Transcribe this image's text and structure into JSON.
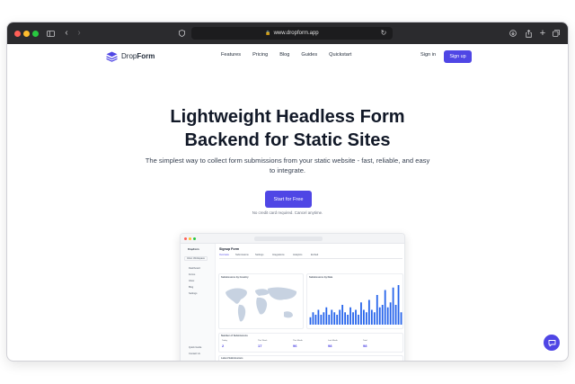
{
  "browser": {
    "url": "www.dropform.app",
    "colors": {
      "close": "#ff5f57",
      "minimize": "#febc2e",
      "maximize": "#28c840"
    }
  },
  "nav": {
    "brand_prefix": "Drop",
    "brand_suffix": "Form",
    "links": [
      "Features",
      "Pricing",
      "Blog",
      "Guides",
      "Quickstart"
    ],
    "sign_in": "Sign in",
    "sign_up": "Sign up"
  },
  "hero": {
    "title_line1": "Lightweight Headless Form",
    "title_line2": "Backend for Static Sites",
    "subtitle": "The simplest way to collect form submissions from your static website - fast, reliable, and easy to integrate.",
    "cta": "Start for Free",
    "cta_note": "No credit card required. Cancel anytime."
  },
  "preview": {
    "brand": "DropForm",
    "workspace": "Inbox Workspace",
    "side_items": [
      "Dashboard",
      "Forms",
      "Inbox",
      "Blog",
      "Settings"
    ],
    "side_bottom": [
      "Quick Guide",
      "Contact Us"
    ],
    "form_title": "Signup Form",
    "tabs": [
      "Overview",
      "Submissions",
      "Settings",
      "Integrations",
      "Analytics",
      "Embed"
    ],
    "submissions_by_country": "Submissions by Country",
    "submissions_by_date": "Submissions by Date",
    "number_of_submissions": "Number of Submissions",
    "latest_submissions": "Latest Submissions",
    "stats": [
      {
        "label": "Today",
        "value": "2"
      },
      {
        "label": "This Week",
        "value": "17"
      },
      {
        "label": "This Month",
        "value": "96"
      },
      {
        "label": "Last Month",
        "value": "98"
      },
      {
        "label": "Total",
        "value": "98"
      }
    ],
    "bar_values": [
      3,
      5,
      4,
      6,
      4,
      5,
      7,
      4,
      6,
      5,
      4,
      6,
      8,
      5,
      4,
      7,
      5,
      6,
      4,
      9,
      6,
      5,
      10,
      6,
      5,
      12,
      7,
      8,
      14,
      7,
      9,
      15,
      8,
      16,
      5
    ],
    "bar_color": "#2563eb"
  },
  "accent": "#4f46e5"
}
